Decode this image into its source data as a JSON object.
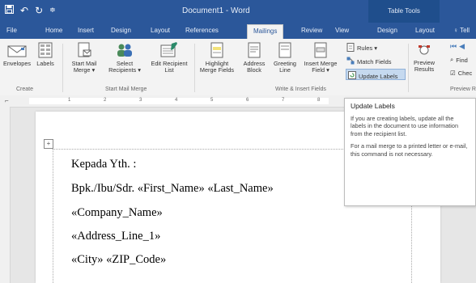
{
  "titlebar": {
    "title": "Document1 - Word",
    "table_tools": "Table Tools"
  },
  "tabs": [
    "File",
    "Home",
    "Insert",
    "Design",
    "Layout",
    "References",
    "Mailings",
    "Review",
    "View",
    "Design",
    "Layout",
    "Tell"
  ],
  "ribbon": {
    "create": {
      "envelopes": "Envelopes",
      "labels": "Labels",
      "group": "Create"
    },
    "start": {
      "start_mail_merge": "Start Mail Merge ▾",
      "select_recipients": "Select Recipients ▾",
      "edit_recipient_list": "Edit Recipient List",
      "group": "Start Mail Merge"
    },
    "write": {
      "highlight": "Highlight Merge Fields",
      "address_block": "Address Block",
      "greeting_line": "Greeting Line",
      "insert_merge_field": "Insert Merge Field ▾",
      "rules": "Rules ▾",
      "match_fields": "Match Fields",
      "update_labels": "Update Labels",
      "group": "Write & Insert Fields"
    },
    "preview": {
      "preview_results": "Preview Results",
      "find": "Find",
      "check": "Chec",
      "group": "Preview R"
    }
  },
  "ruler_numbers": [
    "1",
    "2",
    "3",
    "4",
    "5",
    "6",
    "7",
    "8"
  ],
  "tooltip": {
    "title": "Update Labels",
    "p1": "If you are creating labels, update all the labels in the document to use information from the recipient list.",
    "p2": "For a mail merge to a printed letter or e-mail, this command is not necessary."
  },
  "document": {
    "lines": [
      "Kepada Yth. :",
      "Bpk./Ibu/Sdr. «First_Name» «Last_Name»",
      "«Company_Name»",
      "«Address_Line_1»",
      "«City» «ZIP_Code»"
    ]
  },
  "colors": {
    "accent": "#2b579a",
    "table_tools": "#1f4e8c",
    "highlight": "#c5d9ef"
  }
}
